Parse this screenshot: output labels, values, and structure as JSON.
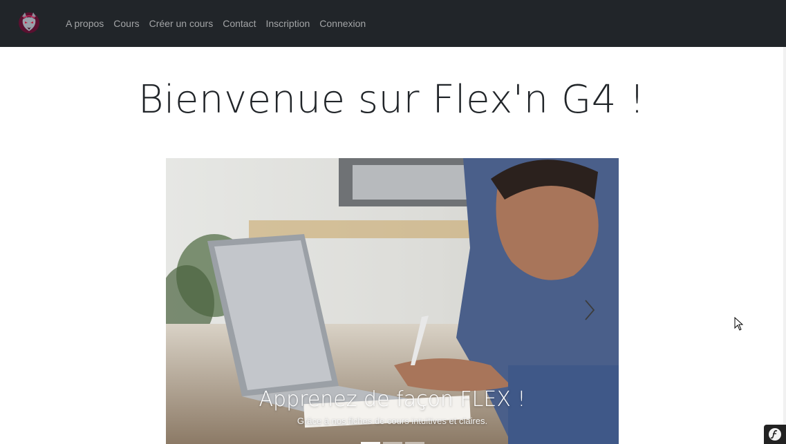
{
  "navbar": {
    "logo_icon": "wolf-logo-icon",
    "links": [
      {
        "label": "A propos"
      },
      {
        "label": "Cours"
      },
      {
        "label": "Créer un cours"
      },
      {
        "label": "Contact"
      },
      {
        "label": "Inscription"
      },
      {
        "label": "Connexion"
      }
    ]
  },
  "main": {
    "title": "Bienvenue sur Flex'n G4 !"
  },
  "carousel": {
    "slide_count": 3,
    "active_index": 0,
    "caption_title": "Apprenez de façon FLEX !",
    "caption_text": "Grâce à nos fiches de cours intuitives et claires.",
    "next_icon": "chevron-right-icon"
  },
  "debug_toolbar": {
    "icon": "symfony-logo-icon"
  },
  "colors": {
    "navbar_bg": "#212529",
    "nav_link": "rgba(255,255,255,0.58)",
    "title_text": "#212529"
  }
}
